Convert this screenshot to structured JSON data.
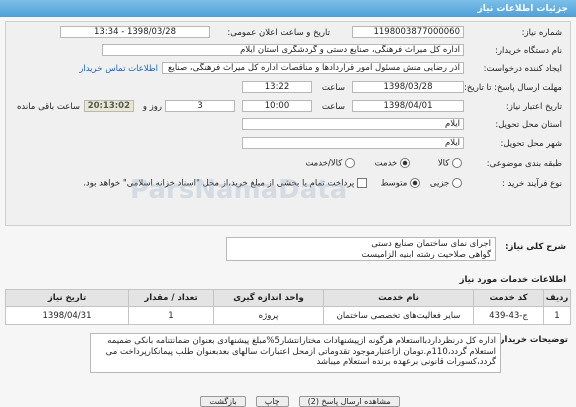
{
  "header": {
    "title": "جزئیات اطلاعات نیاز"
  },
  "form": {
    "need_number_label": "شماره نیاز:",
    "need_number": "1198003877000060",
    "announce_label": "تاریخ و ساعت اعلان عمومی:",
    "announce_value": "1398/03/28 - 13:34",
    "buyer_label": "نام دستگاه خریدار:",
    "buyer_value": "اداره کل میراث فرهنگی، صنایع دستی و گردشگری استان ایلام",
    "creator_label": "ایجاد کننده درخواست:",
    "creator_value": "آذر رضایی منش مسئول امور قراردادها و مناقصات اداره کل میراث فرهنگی، صنایع",
    "contact_link": "اطلاعات تماس خریدار",
    "send_deadline_label": "مهلت ارسال پاسخ: تا تاریخ:",
    "send_date": "1398/03/28",
    "time_label": "ساعت",
    "send_time": "13:22",
    "validity_label": "تاریخ اعتبار نیاز:",
    "validity_date": "1398/04/01",
    "validity_time": "10:00",
    "days_value": "3",
    "days_label": "روز و",
    "remaining_time": "20:13:02",
    "remaining_label": "ساعت باقی مانده",
    "province_label": "استان محل تحویل:",
    "province_value": "ایلام",
    "city_label": "شهر محل تحویل:",
    "city_value": "ایلام",
    "category_label": "طبقه بندی موضوعی:",
    "category_goods": "کالا",
    "category_service": "خدمت",
    "category_goods_service": "کالا/خدمت",
    "process_label": "نوع فرآیند خرید :",
    "process_partial": "جزیی",
    "process_medium": "متوسط",
    "payment_note": "پرداخت تمام یا بخشی از مبلغ خرید،از محل \"اسناد خزانه اسلامی\" خواهد بود."
  },
  "description": {
    "label": "شرح کلی نیاز:",
    "line1": "اجرای نمای ساختمان صنایع دستی",
    "line2": "گواهی صلاحیت رشته ابنیه الزامیست"
  },
  "services": {
    "section_title": "اطلاعات خدمات مورد نیاز",
    "columns": [
      "ردیف",
      "کد خدمت",
      "نام خدمت",
      "واحد اندازه گیری",
      "تعداد / مقدار",
      "تاریخ نیاز"
    ],
    "rows": [
      [
        "1",
        "ج-43-439",
        "سایر فعالیت‌های تخصصی ساختمان",
        "پروژه",
        "1",
        "1398/04/31"
      ]
    ]
  },
  "buyer_notes": {
    "label": "توضیحات خریدار:",
    "text": "اداره کل درنظرداردبااستعلام هرگونه ازپیشنهادات مختارانتشار5%مبلغ پیشنهادی بعنوان ضمانتنامه بانکی ضمیمه استعلام گردد،110م.تومان ازاعتبارموجود تقدوماتی ازمحل اعتبارات سالهای بعدبعنوان طلب پیمانکارپرداخت می گردد،کسورات قانونی برعهده برنده استعلام میباشد"
  },
  "actions": {
    "back_label": "بازگشت",
    "print_label": "چاپ",
    "answer_label": "مشاهده ارسال پاسخ (2)"
  },
  "colors": {
    "header": "#4f9fd6",
    "link": "#1a63c4"
  }
}
